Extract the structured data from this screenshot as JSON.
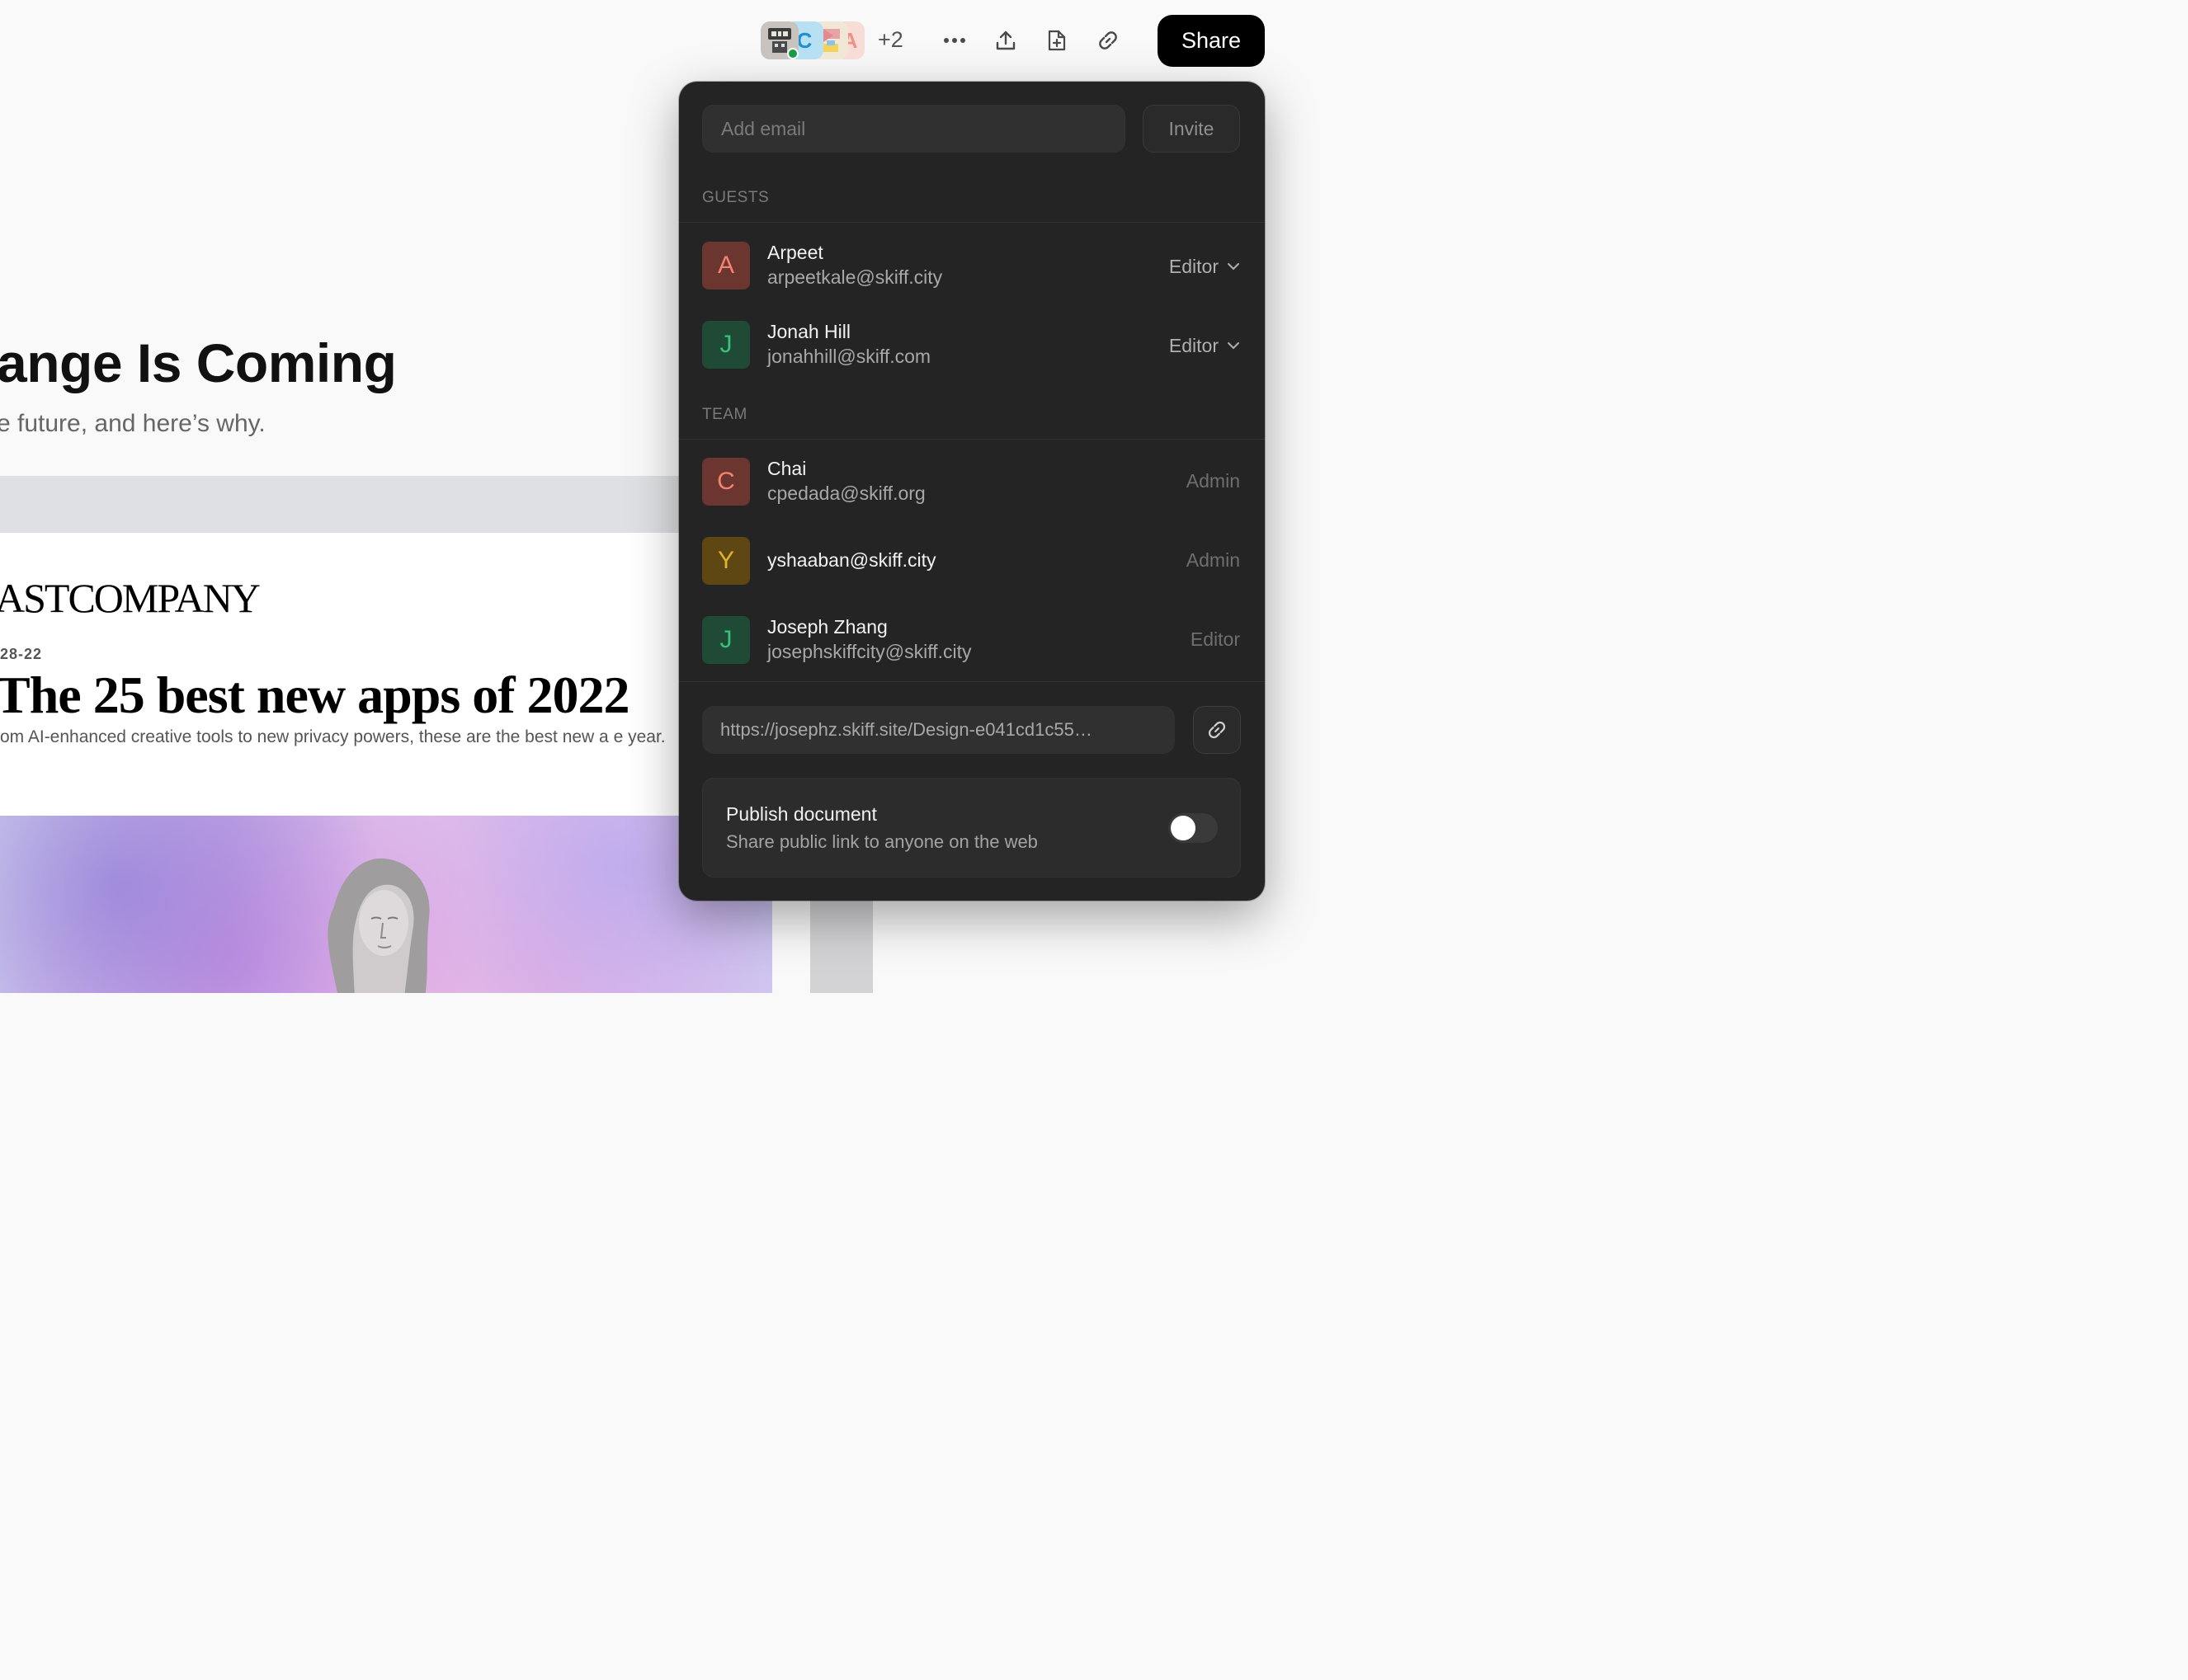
{
  "toolbar": {
    "collaborators": [
      {
        "initial": "",
        "icon": "robot-avatar-icon",
        "bg": "#c9c3bf",
        "online": true
      },
      {
        "initial": "C",
        "bg": "#b7e0f3",
        "color": "#1f8fd0"
      },
      {
        "initial": "",
        "icon": "illustration-avatar-icon",
        "bg": "#f1e7d6"
      },
      {
        "initial": "A",
        "bg": "#f8dcd8",
        "color": "#f08f84"
      }
    ],
    "extra_count": "+2",
    "icons": [
      "more-icon",
      "upload-icon",
      "new-document-icon",
      "link-icon"
    ],
    "share_label": "Share"
  },
  "document": {
    "title": "ange Is Coming",
    "subtitle": "e future, and here’s why.",
    "article": {
      "logo": "ASTCOMPANY",
      "date": "28-22",
      "headline": "The 25 best new apps of 2022",
      "dek": "om AI-enhanced creative tools to new privacy powers, these are the best new a e year."
    }
  },
  "share_panel": {
    "email_placeholder": "Add email",
    "invite_label": "Invite",
    "guests_label": "GUESTS",
    "guests": [
      {
        "initial": "A",
        "name": "Arpeet",
        "email": "arpeetkale@skiff.city",
        "role": "Editor",
        "bg": "#6b3530",
        "fg": "#f4846f"
      },
      {
        "initial": "J",
        "name": "Jonah Hill",
        "email": "jonahhill@skiff.com",
        "role": "Editor",
        "bg": "#1f4a35",
        "fg": "#37c27c"
      }
    ],
    "team_label": "TEAM",
    "team": [
      {
        "initial": "C",
        "name": "Chai",
        "email": "cpedada@skiff.org",
        "role": "Admin",
        "bg": "#6b3530",
        "fg": "#f4846f"
      },
      {
        "initial": "Y",
        "name": "",
        "email": "yshaaban@skiff.city",
        "role": "Admin",
        "bg": "#5e4712",
        "fg": "#e4b32e"
      },
      {
        "initial": "J",
        "name": "Joseph Zhang",
        "email": "josephskiffcity@skiff.city",
        "role": "Editor",
        "bg": "#1f4a35",
        "fg": "#37c27c"
      }
    ],
    "link_url": "https://josephz.skiff.site/Design-e041cd1c55…",
    "publish": {
      "title": "Publish document",
      "description": "Share public link to anyone on the web",
      "enabled": false
    }
  }
}
